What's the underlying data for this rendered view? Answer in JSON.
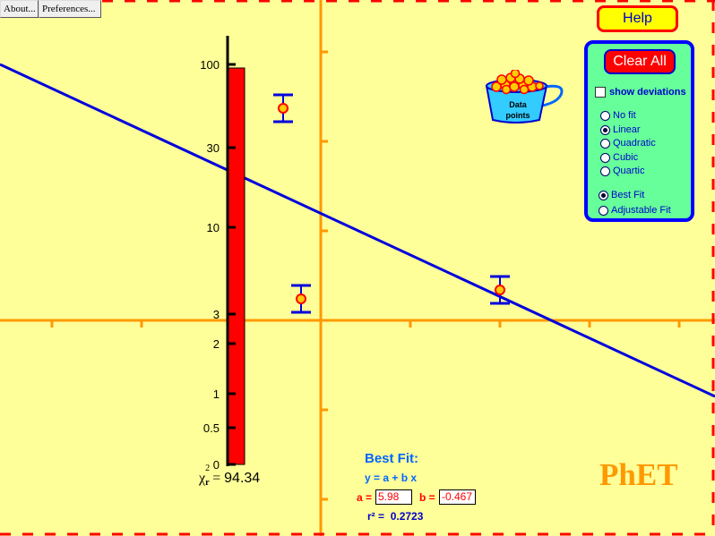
{
  "menu": {
    "about_label": "About...",
    "preferences_label": "Preferences..."
  },
  "colors": {
    "background": "#ffff99",
    "axis": "#ff9900",
    "fit_line": "#0000dd",
    "border_dash": "#ff0000",
    "chi_bar": "#ff0000",
    "panel": "#66ff99",
    "panel_border": "#0000ff"
  },
  "help": {
    "label": "Help"
  },
  "controls": {
    "clear_label": "Clear All",
    "show_deviations": {
      "label": "show deviations",
      "checked": false
    },
    "fit_types": [
      {
        "label": "No fit",
        "selected": false
      },
      {
        "label": "Linear",
        "selected": true
      },
      {
        "label": "Quadratic",
        "selected": false
      },
      {
        "label": "Cubic",
        "selected": false
      },
      {
        "label": "Quartic",
        "selected": false
      }
    ],
    "fit_modes": [
      {
        "label": "Best Fit",
        "selected": true
      },
      {
        "label": "Adjustable Fit",
        "selected": false
      }
    ]
  },
  "bucket": {
    "line1": "Data",
    "line2": "points"
  },
  "chi_meter": {
    "ticks": [
      "100",
      "30",
      "10",
      "3",
      "2",
      "1",
      "0.5",
      "0"
    ],
    "value": 94.34,
    "symbol": "χ",
    "sup": "2",
    "sub": "r",
    "equals": "=",
    "value_text": "94.34"
  },
  "chart_data": {
    "type": "scatter",
    "title": "",
    "xlabel": "",
    "ylabel": "",
    "x_range": [
      -3.58,
      4.4
    ],
    "y_range": [
      -2.41,
      3.58
    ],
    "x_ticks": [
      -3,
      -2,
      -1,
      1,
      2,
      3,
      4
    ],
    "y_ticks": [
      -2,
      -1,
      1,
      2,
      3
    ],
    "grid": false,
    "points": [
      {
        "x": -0.42,
        "y": 2.37,
        "error": 0.15
      },
      {
        "x": -0.22,
        "y": 0.24,
        "error": 0.15
      },
      {
        "x": 2.0,
        "y": 0.34,
        "error": 0.15
      }
    ],
    "fit": {
      "type": "linear",
      "a": 5.98,
      "b": -0.467
    }
  },
  "fit_panel": {
    "title": "Best Fit:",
    "equation": "y = a + b x",
    "a_label": "a =",
    "a_value": "5.98",
    "b_label": "b =",
    "b_value": "-0.467",
    "r2_label": "r² =",
    "r2_value": "0.2723"
  },
  "logo": "PhET"
}
